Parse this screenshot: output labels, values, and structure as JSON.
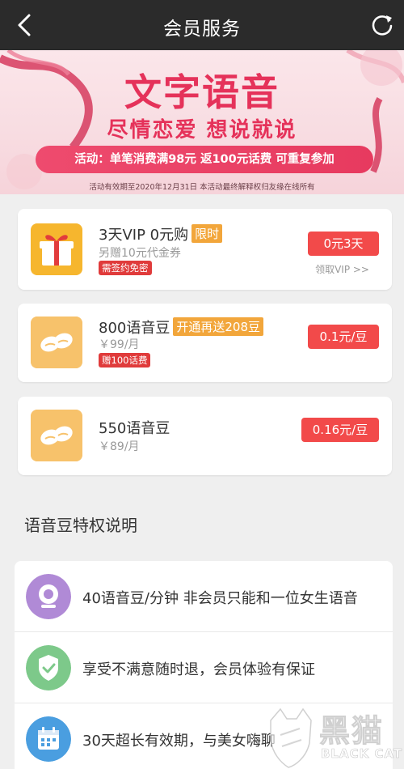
{
  "nav": {
    "title": "会员服务",
    "back_icon": "chevron-left-icon",
    "refresh_icon": "refresh-icon"
  },
  "banner": {
    "title": "文字语音",
    "subtitle": "尽情恋爱  想说就说",
    "promo": "活动：单笔消费满98元  返100元话费  可重复参加",
    "note": "活动有效期至2020年12月31日  本活动最终解释权归友缘在线所有"
  },
  "products": [
    {
      "name": "3天VIP 0元购",
      "badge": "限时",
      "sub": "另赠10元代金券",
      "red_tag": "需签约免密",
      "price": "0元3天",
      "link": "领取VIP >>",
      "icon": "gift-icon"
    },
    {
      "name": "800语音豆",
      "badge": "开通再送208豆",
      "sub": "￥99/月",
      "red_tag": "赠100话费",
      "price": "0.1元/豆",
      "icon": "beans-icon"
    },
    {
      "name": "550语音豆",
      "sub": "￥89/月",
      "price": "0.16元/豆",
      "icon": "beans-icon"
    }
  ],
  "section_title": "语音豆特权说明",
  "features": [
    {
      "text": "40语音豆/分钟  非会员只能和一位女生语音",
      "icon": "camera-icon",
      "color": "#b08ad6"
    },
    {
      "text": "享受不满意随时退，会员体验有保证",
      "icon": "shield-check-icon",
      "color": "#7dc98a"
    },
    {
      "text": "30天超长有效期，与美女嗨聊",
      "icon": "calendar-icon",
      "color": "#4a9ee0"
    }
  ],
  "watermark": {
    "cn": "黑猫",
    "en": "BLACK CAT"
  },
  "colors": {
    "accent": "#e5325a",
    "price_red": "#f24a4a",
    "tag_orange": "#f2a63b",
    "navbar": "#2b2b2b"
  }
}
